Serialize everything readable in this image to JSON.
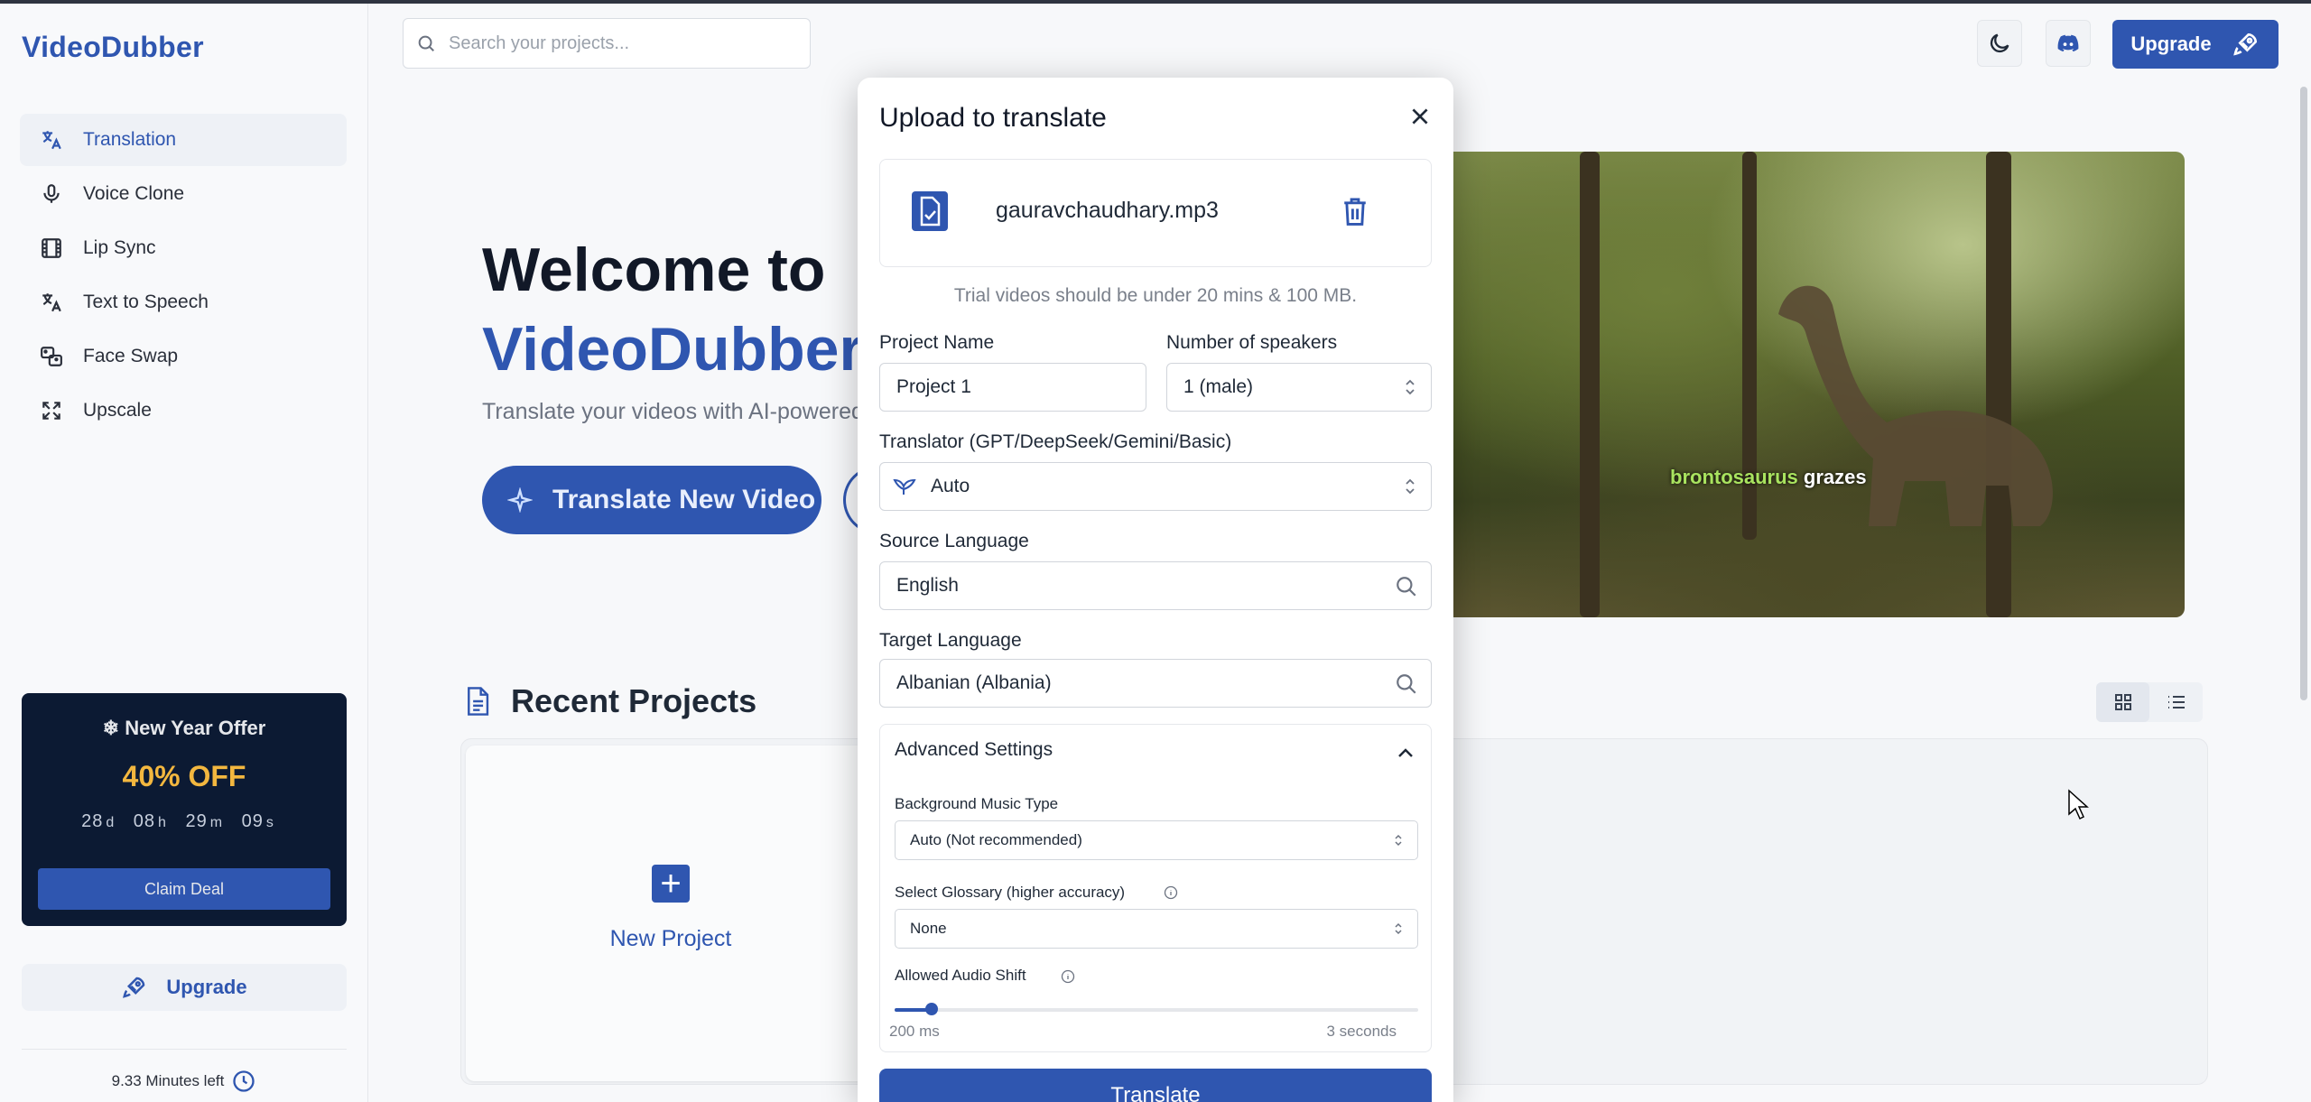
{
  "app": {
    "brand": "VideoDubber"
  },
  "sidebar": {
    "items": [
      {
        "label": "Translation",
        "icon": "translate-icon",
        "active": true
      },
      {
        "label": "Voice Clone",
        "icon": "microphone-icon",
        "active": false
      },
      {
        "label": "Lip Sync",
        "icon": "film-icon",
        "active": false
      },
      {
        "label": "Text to Speech",
        "icon": "text-translate-icon",
        "active": false
      },
      {
        "label": "Face Swap",
        "icon": "face-swap-icon",
        "active": false
      },
      {
        "label": "Upscale",
        "icon": "expand-icon",
        "active": false
      }
    ],
    "offer": {
      "title": "New Year Offer",
      "discount": "40% OFF",
      "timer": {
        "days": "28",
        "hours": "08",
        "minutes": "29",
        "seconds": "09",
        "d": "d",
        "h": "h",
        "m": "m",
        "s": "s"
      },
      "claim_label": "Claim Deal"
    },
    "upgrade_label": "Upgrade",
    "minutes_left": "9.33 Minutes left"
  },
  "header": {
    "search_placeholder": "Search your projects...",
    "upgrade_label": "Upgrade"
  },
  "hero": {
    "title_line1": "Welcome to",
    "title_line2": "VideoDubber.ai",
    "subtitle": "Translate your videos with AI-powered",
    "cta_label": "Translate New Video"
  },
  "video": {
    "caption_highlight": "brontosaurus",
    "caption_rest": "grazes"
  },
  "recent": {
    "title": "Recent Projects",
    "new_project_label": "New Project"
  },
  "modal": {
    "title": "Upload to translate",
    "file_name": "gauravchaudhary.mp3",
    "trial_note": "Trial videos should be under 20 mins & 100 MB.",
    "project_name_label": "Project Name",
    "project_name_value": "Project 1",
    "speakers_label": "Number of speakers",
    "speakers_value": "1 (male)",
    "translator_label": "Translator (GPT/DeepSeek/Gemini/Basic)",
    "translator_value": "Auto",
    "source_label": "Source Language",
    "source_value": "English",
    "target_label": "Target Language",
    "target_value": "Albanian (Albania)",
    "advanced": {
      "title": "Advanced Settings",
      "music_label": "Background Music Type",
      "music_value": "Auto (Not recommended)",
      "glossary_label": "Select Glossary (higher accuracy)",
      "glossary_value": "None",
      "shift_label": "Allowed Audio Shift",
      "shift_min": "200 ms",
      "shift_max": "3 seconds",
      "shift_fraction": 0.07
    },
    "submit_label": "Translate"
  },
  "colors": {
    "accent": "#2f56b0",
    "offer_bg": "#0c1a33",
    "offer_gold": "#f3b73f"
  }
}
